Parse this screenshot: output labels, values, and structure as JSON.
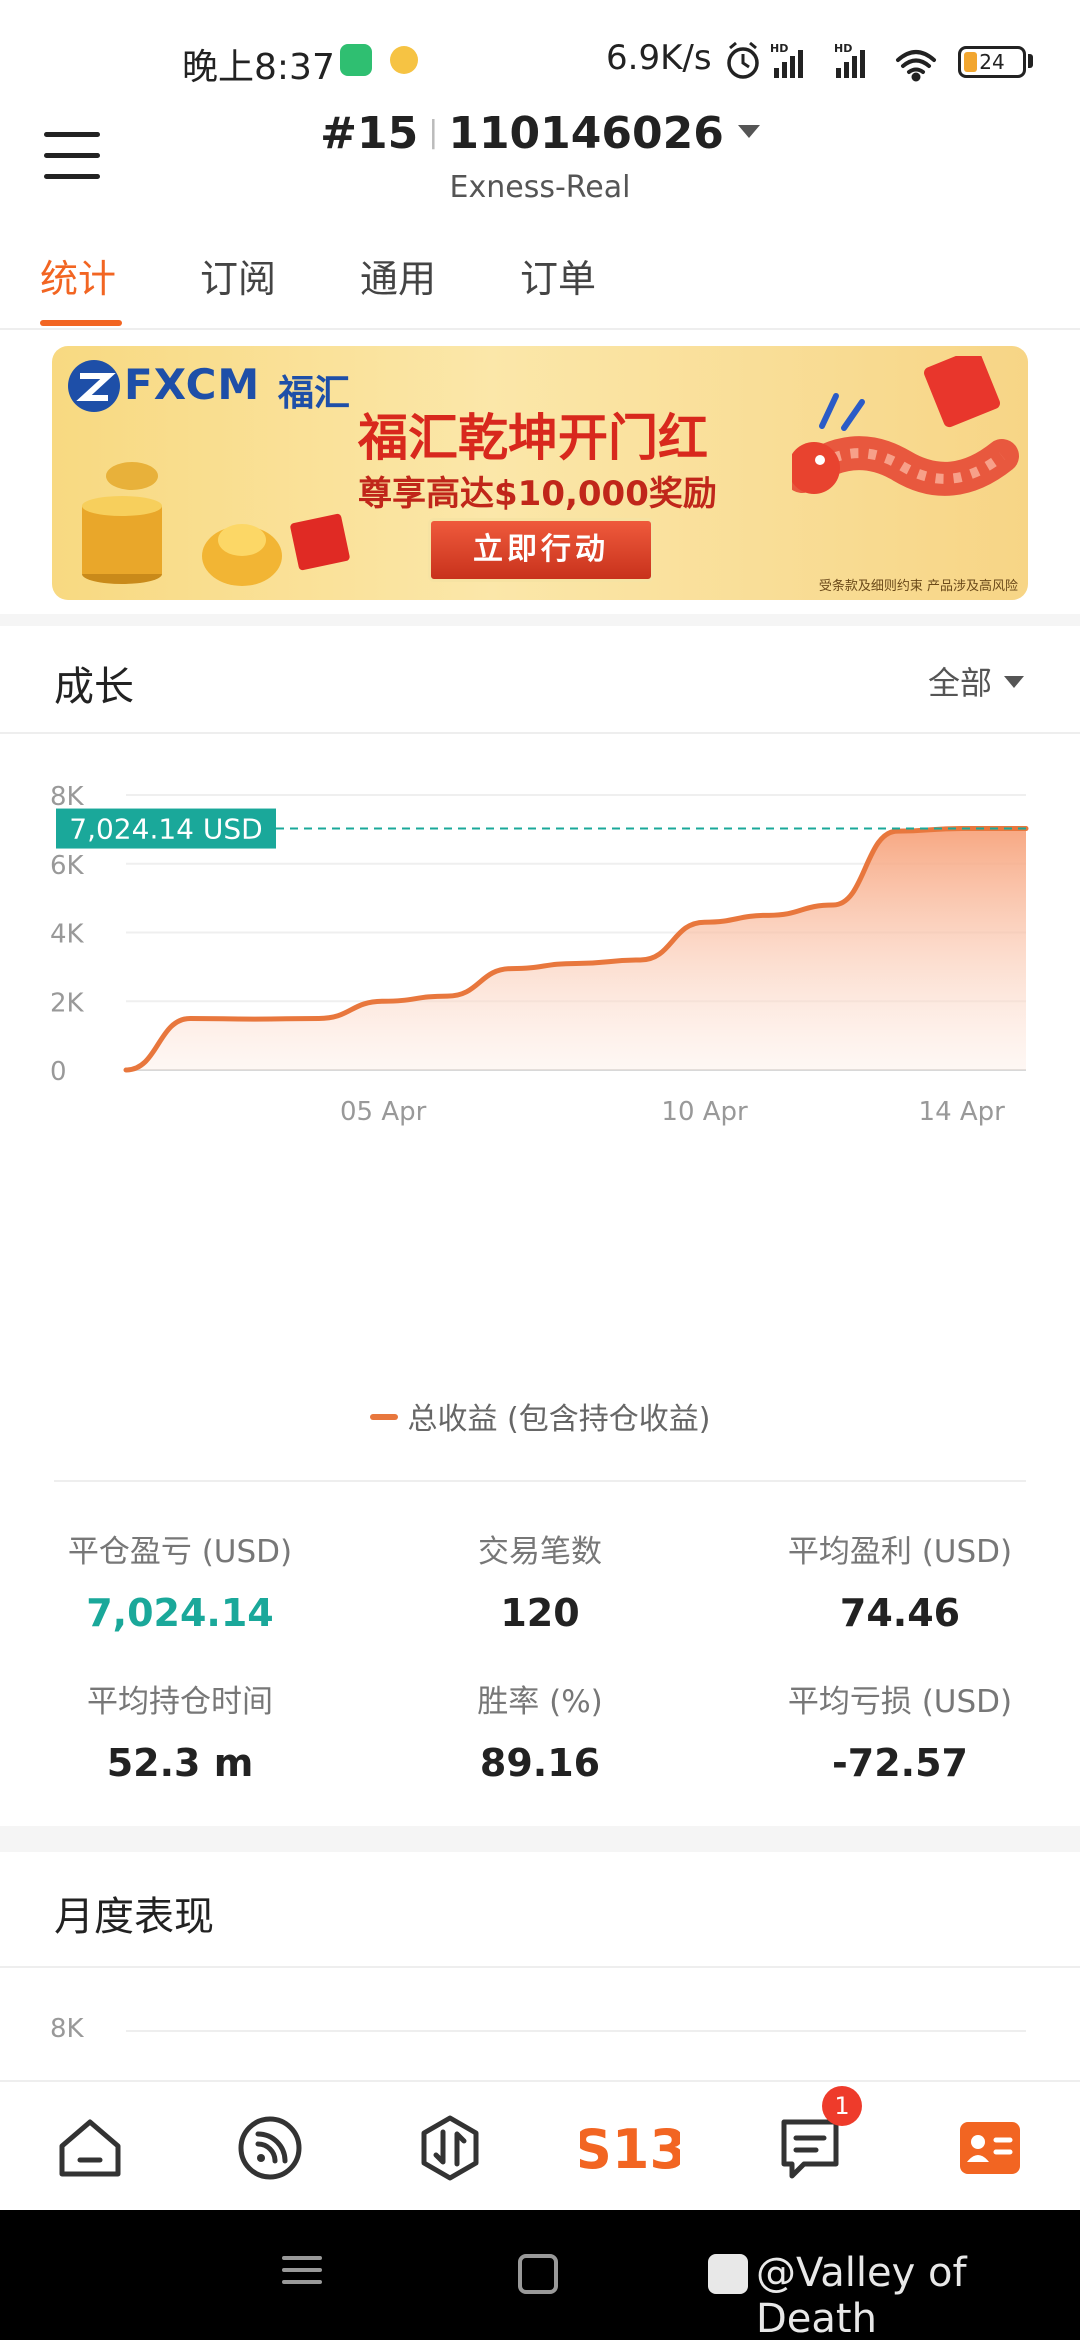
{
  "status_bar": {
    "time": "晚上8:37",
    "net_speed": "6.9K/s",
    "battery": "24",
    "battery_level": 0.24
  },
  "header": {
    "account_index": "#15",
    "account_number": "110146026",
    "server": "Exness-Real"
  },
  "tabs": [
    {
      "label": "统计",
      "active": true
    },
    {
      "label": "订阅",
      "active": false
    },
    {
      "label": "通用",
      "active": false
    },
    {
      "label": "订单",
      "active": false
    }
  ],
  "banner": {
    "brand": "FXCM",
    "brand_cn": "福汇",
    "title": "福汇乾坤开门红",
    "subtitle": "尊享高达$10,000奖励",
    "cta": "立即行动",
    "disclaimer": "受条款及细则约束  产品涉及高风险"
  },
  "growth": {
    "title": "成长",
    "filter": "全部",
    "current_value_label": "7,024.14 USD",
    "legend": "总收益 (包含持仓收益)",
    "colors": {
      "line": "#e8773d",
      "highlight": "#1aa89a"
    }
  },
  "chart_data": {
    "type": "area",
    "x": [
      "01 Apr",
      "02 Apr",
      "03 Apr",
      "04 Apr",
      "05 Apr",
      "06 Apr",
      "07 Apr",
      "08 Apr",
      "09 Apr",
      "10 Apr",
      "11 Apr",
      "12 Apr",
      "13 Apr",
      "14 Apr",
      "15 Apr"
    ],
    "values": [
      0,
      1500,
      1480,
      1500,
      2000,
      2150,
      2950,
      3100,
      3200,
      4300,
      4500,
      4800,
      6950,
      7024.14,
      7024.14
    ],
    "series": [
      {
        "name": "总收益 (包含持仓收益)",
        "color": "#e8773d"
      }
    ],
    "x_tick_labels": [
      "05 Apr",
      "10 Apr",
      "14 Apr"
    ],
    "y_tick_labels": [
      "0",
      "2K",
      "4K",
      "6K",
      "8K"
    ],
    "y_ticks": [
      0,
      2000,
      4000,
      6000,
      8000
    ],
    "ylim": [
      0,
      8000
    ],
    "grid": true,
    "reference_line": 7024.14,
    "reference_label": "7,024.14 USD"
  },
  "stats": [
    {
      "label": "平仓盈亏 (USD)",
      "value": "7,024.14",
      "highlight": true
    },
    {
      "label": "交易笔数",
      "value": "120",
      "highlight": false
    },
    {
      "label": "平均盈利 (USD)",
      "value": "74.46",
      "highlight": false
    },
    {
      "label": "平均持仓时间",
      "value": "52.3 m",
      "highlight": false
    },
    {
      "label": "胜率 (%)",
      "value": "89.16",
      "highlight": false
    },
    {
      "label": "平均亏损 (USD)",
      "value": "-72.57",
      "highlight": false
    }
  ],
  "monthly": {
    "title": "月度表现",
    "top_tick": "8K"
  },
  "bottom_nav": {
    "badge": "1",
    "center_logo": "S13",
    "items": [
      "home-icon",
      "feed-icon",
      "trade-icon",
      "s13-logo-icon",
      "messages-icon",
      "profile-card-icon"
    ]
  },
  "watermark": "@Valley of Death"
}
